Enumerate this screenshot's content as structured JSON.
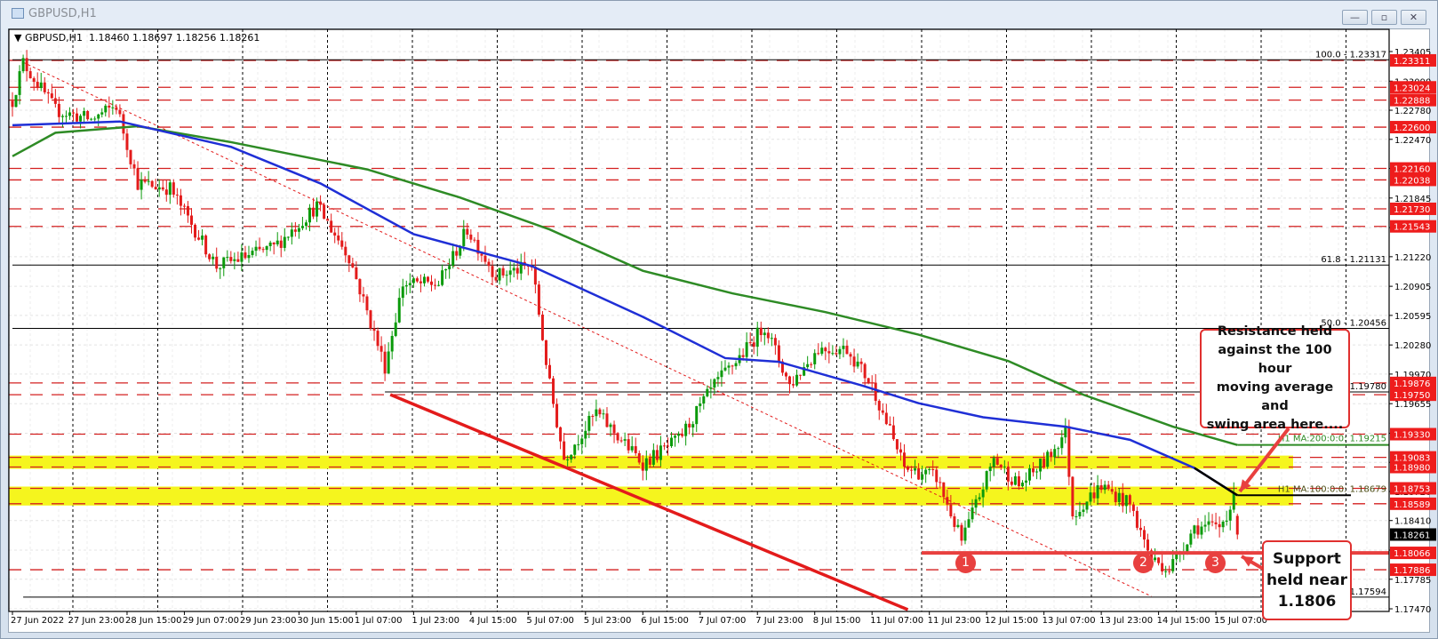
{
  "window": {
    "title": "GBPUSD,H1",
    "buttons": {
      "minimize": "—",
      "restore": "▫",
      "close": "✕"
    }
  },
  "legend": {
    "arrow": "▼",
    "symbol": "GBPUSD,H1",
    "ohlc": "1.18460 1.18697 1.18256 1.18261"
  },
  "annotations": {
    "resistance_lines": [
      "Resistance held",
      "against the 100 hour",
      "moving average and",
      "swing area here...."
    ],
    "support_lines": [
      "Support",
      "held near",
      "1.1806"
    ],
    "touches": [
      "1",
      "2",
      "3"
    ]
  },
  "colors": {
    "bull": "#0a9a0a",
    "bear": "#e31b1b",
    "ma100": "#1f2fd6",
    "ma200": "#2e8b25",
    "level": "#d42020",
    "zone": "#f5f51e",
    "annotation": "#e8403f"
  },
  "chart_data": {
    "type": "candlestick",
    "symbol": "GBPUSD",
    "timeframe": "H1",
    "ylim": [
      1.17442,
      1.23642
    ],
    "price_ticks": [
      "1.23405",
      "1.23090",
      "1.22780",
      "1.22470",
      "1.22160",
      "1.21845",
      "1.21530",
      "1.21220",
      "1.20905",
      "1.20595",
      "1.20280",
      "1.19970",
      "1.19655",
      "1.19340",
      "1.19030",
      "1.18720",
      "1.18410",
      "1.18095",
      "1.17785",
      "1.17470"
    ],
    "time_labels": [
      "27 Jun 2022",
      "27 Jun 23:00",
      "28 Jun 15:00",
      "29 Jun 07:00",
      "29 Jun 23:00",
      "30 Jun 15:00",
      "1 Jul 07:00",
      "1 Jul 23:00",
      "4 Jul 15:00",
      "5 Jul 07:00",
      "5 Jul 23:00",
      "6 Jul 15:00",
      "7 Jul 07:00",
      "7 Jul 23:00",
      "8 Jul 15:00",
      "11 Jul 07:00",
      "11 Jul 23:00",
      "12 Jul 15:00",
      "13 Jul 07:00",
      "13 Jul 23:00",
      "14 Jul 15:00",
      "15 Jul 07:00"
    ],
    "bars_per_time_label": 16,
    "bar_count": 343,
    "price_path": [
      [
        0,
        1.2288
      ],
      [
        3,
        1.2329
      ],
      [
        12,
        1.2278
      ],
      [
        22,
        1.2268
      ],
      [
        29,
        1.2283
      ],
      [
        35,
        1.22
      ],
      [
        44,
        1.2195
      ],
      [
        57,
        1.2112
      ],
      [
        73,
        1.2132
      ],
      [
        85,
        1.2176
      ],
      [
        94,
        1.2122
      ],
      [
        104,
        1.2005
      ],
      [
        109,
        1.2093
      ],
      [
        119,
        1.2093
      ],
      [
        127,
        1.2151
      ],
      [
        135,
        1.2102
      ],
      [
        145,
        1.2112
      ],
      [
        150,
        1.1985
      ],
      [
        154,
        1.1907
      ],
      [
        163,
        1.1956
      ],
      [
        176,
        1.1902
      ],
      [
        186,
        1.1927
      ],
      [
        196,
        1.1985
      ],
      [
        205,
        1.2024
      ],
      [
        210,
        1.2049
      ],
      [
        217,
        1.1985
      ],
      [
        225,
        1.2024
      ],
      [
        233,
        1.2024
      ],
      [
        240,
        1.1985
      ],
      [
        249,
        1.1897
      ],
      [
        258,
        1.1887
      ],
      [
        265,
        1.1819
      ],
      [
        274,
        1.1907
      ],
      [
        281,
        1.1878
      ],
      [
        289,
        1.1907
      ],
      [
        294,
        1.1936
      ],
      [
        296,
        1.1848
      ],
      [
        304,
        1.1878
      ],
      [
        312,
        1.1858
      ],
      [
        318,
        1.18
      ],
      [
        323,
        1.179
      ],
      [
        330,
        1.1834
      ],
      [
        337,
        1.1834
      ],
      [
        341,
        1.1863
      ],
      [
        342,
        1.18261
      ]
    ],
    "ma100": {
      "label": "H1 MA:100:0:0: 1.18679",
      "value": 1.18679,
      "path": [
        [
          0,
          1.2262
        ],
        [
          30,
          1.2266
        ],
        [
          61,
          1.2239
        ],
        [
          86,
          1.22
        ],
        [
          112,
          1.2146
        ],
        [
          145,
          1.2112
        ],
        [
          176,
          1.2058
        ],
        [
          199,
          1.2014
        ],
        [
          214,
          1.201
        ],
        [
          237,
          1.1985
        ],
        [
          253,
          1.1966
        ],
        [
          271,
          1.1951
        ],
        [
          294,
          1.1941
        ],
        [
          312,
          1.1927
        ],
        [
          330,
          1.1897
        ],
        [
          342,
          1.18679
        ]
      ]
    },
    "ma200": {
      "label": "H1 MA:200:0:0: 1.19215",
      "value": 1.19215,
      "path": [
        [
          0,
          1.2229
        ],
        [
          12,
          1.2254
        ],
        [
          35,
          1.2261
        ],
        [
          61,
          1.2244
        ],
        [
          99,
          1.2215
        ],
        [
          125,
          1.2185
        ],
        [
          150,
          1.2151
        ],
        [
          176,
          1.2107
        ],
        [
          201,
          1.2083
        ],
        [
          227,
          1.2063
        ],
        [
          253,
          1.2039
        ],
        [
          278,
          1.2011
        ],
        [
          299,
          1.1975
        ],
        [
          324,
          1.1941
        ],
        [
          342,
          1.19215
        ]
      ]
    },
    "red_levels": [
      "1.23311",
      "1.23024",
      "1.22888",
      "1.22600",
      "1.22160",
      "1.22038",
      "1.21730",
      "1.21543",
      "1.19876",
      "1.19750",
      "1.19330",
      "1.19083",
      "1.18980",
      "1.18753",
      "1.18589",
      "1.18066",
      "1.17886"
    ],
    "support_level": "1.18066",
    "current_price": "1.18261",
    "fib_levels": [
      {
        "label": "100.0 - 1.23317",
        "price": 1.23317,
        "from_bar": 0
      },
      {
        "label": "61.8 - 1.21131",
        "price": 1.21131,
        "from_bar": 0
      },
      {
        "label": "50.0 - 1.20456",
        "price": 1.20456,
        "from_bar": 0
      },
      {
        "label": "- 1.19780",
        "price": 1.1978,
        "from_bar": 104
      },
      {
        "label": "-1.17594",
        "price": 1.17594,
        "from_bar": 3
      }
    ],
    "zones": [
      [
        1.1898,
        1.19083
      ],
      [
        1.18589,
        1.18753
      ]
    ],
    "trendlines": [
      {
        "style": "thick",
        "from": [
          105.5,
          1.19751
        ],
        "to": [
          250,
          1.17461
        ]
      },
      {
        "style": "dashed",
        "from": [
          3,
          1.2329
        ],
        "to": [
          318,
          1.17603
        ]
      }
    ],
    "touch_points": [
      [
        266,
        1.18066
      ],
      [
        316,
        1.18066
      ],
      [
        336,
        1.18066
      ]
    ]
  }
}
